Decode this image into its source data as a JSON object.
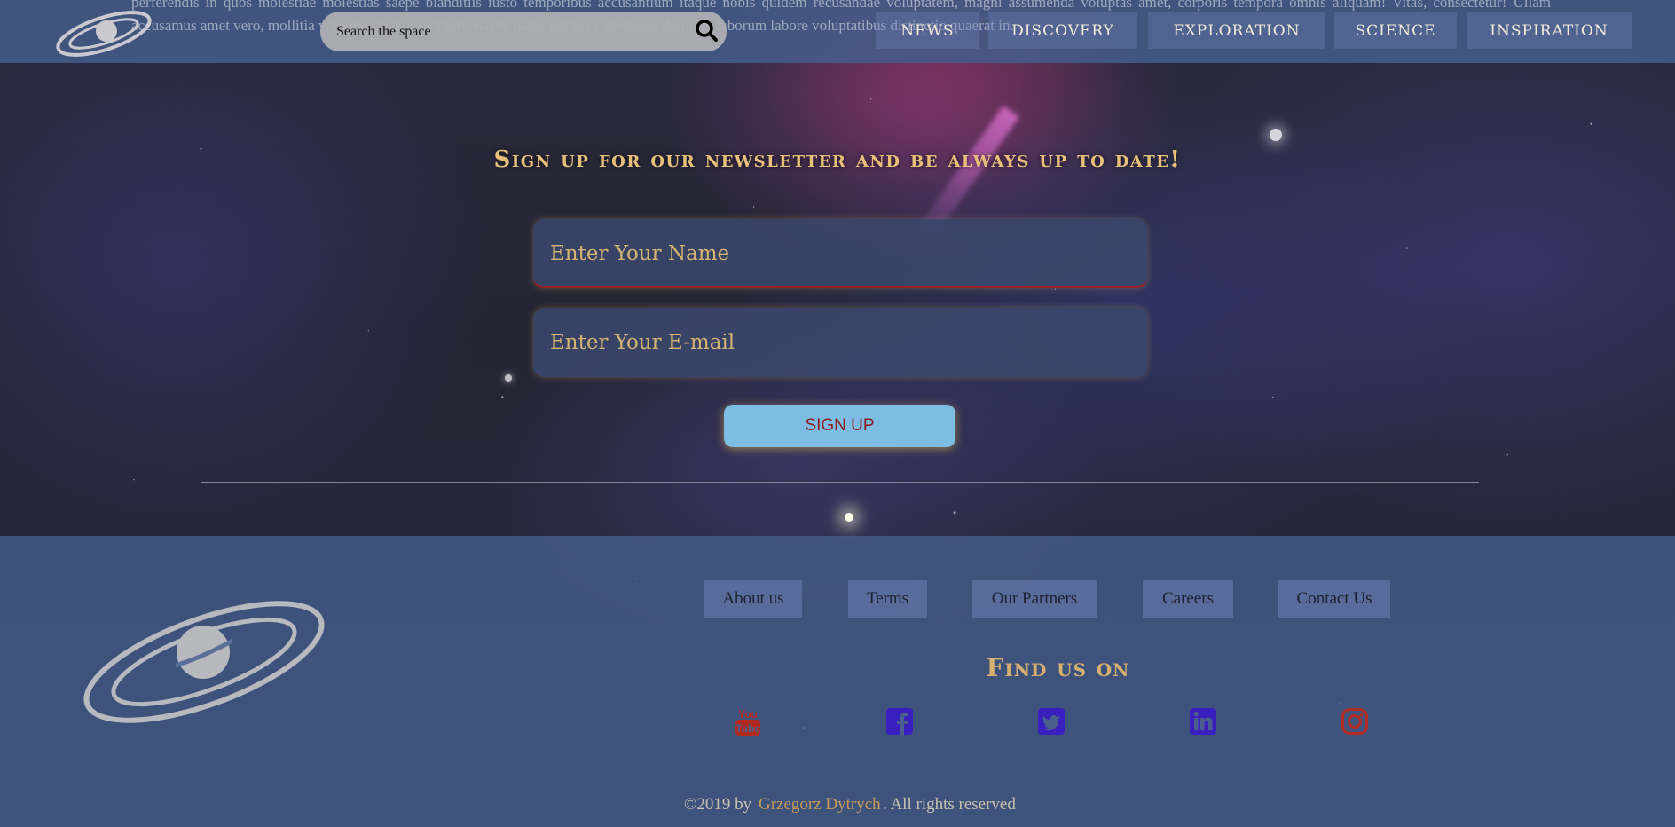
{
  "background_lorem": "perferendis in quos molestiae molestias saepe blanditiis iusto temporibus accusantium itaque nobis quidem recusandae voluptatem, magni assumenda voluptas amet, corporis tempora omnis aliquam! Vitas, consectetur! Ullam accusamus amet vero, mollitia voluptatum praesentium, earum natus tempora similique dolorem laborum labore voluptatibus distinctio quaerat in.",
  "search": {
    "placeholder": "Search the space",
    "icon": "search-icon"
  },
  "nav": [
    "NEWS",
    "DISCOVERY",
    "EXPLORATION",
    "SCIENCE",
    "INSPIRATION"
  ],
  "newsletter": {
    "headline": "Sign up for our newsletter and be always up to date!",
    "name_placeholder": "Enter Your Name",
    "email_placeholder": "Enter Your E-mail",
    "button": "SIGN UP"
  },
  "footer": {
    "links": [
      "About us",
      "Terms",
      "Our Partners",
      "Careers",
      "Contact Us"
    ],
    "find_us": "Find us on",
    "social": [
      {
        "name": "youtube-icon",
        "color": "#b02a22"
      },
      {
        "name": "facebook-icon",
        "color": "#3a1fbf"
      },
      {
        "name": "twitter-icon",
        "color": "#3a1fbf"
      },
      {
        "name": "linkedin-icon",
        "color": "#3a1fbf"
      },
      {
        "name": "instagram-icon",
        "color": "#b02a22"
      }
    ],
    "copyright_prefix": "©2019 by",
    "copyright_author": "Grzegorz Dytrych",
    "copyright_suffix": ". All rights reserved"
  },
  "colors": {
    "accent_gold": "#e8c07a",
    "button_bg": "#7dbde4",
    "button_text": "#8b1a1a",
    "header_bg": "#445f8c"
  }
}
